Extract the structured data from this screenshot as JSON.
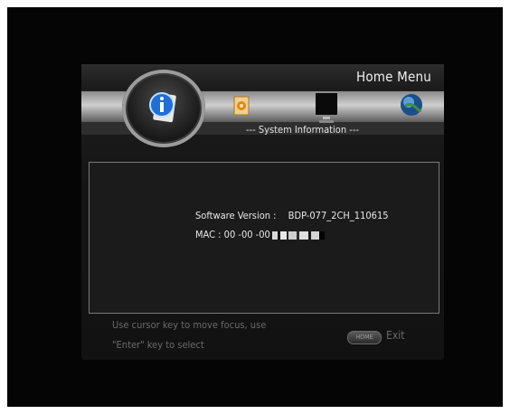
{
  "header": {
    "title": "Home Menu"
  },
  "icons": {
    "main": "info-icon",
    "items": [
      "settings-icon",
      "monitor-icon",
      "globe-icon"
    ]
  },
  "section": {
    "label": "--- System Information ---"
  },
  "info": {
    "software_label": "Software Version :",
    "software_value": "BDP-077_2CH_110615",
    "mac_prefix": "MAC : 00 -00 -00"
  },
  "footer": {
    "hint_line1": "Use cursor key to move focus, use",
    "hint_line2": "\"Enter\" key to select",
    "home_button": "HOME",
    "exit_label": "Exit"
  }
}
